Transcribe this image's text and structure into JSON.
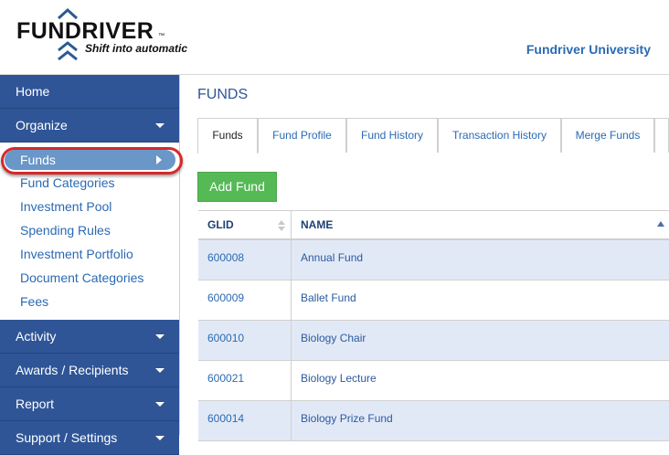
{
  "header": {
    "logo_text": "FUNDRIVER",
    "logo_tm": "™",
    "logo_tagline": "Shift into automatic",
    "org_name": "Fundriver University"
  },
  "sidebar": {
    "top_items": [
      {
        "label": "Home"
      },
      {
        "label": "Organize"
      }
    ],
    "active_item": "Funds",
    "sub_items": [
      {
        "label": "Fund Categories"
      },
      {
        "label": "Investment Pool"
      },
      {
        "label": "Spending Rules"
      },
      {
        "label": "Investment Portfolio"
      },
      {
        "label": "Document Categories"
      },
      {
        "label": "Fees"
      }
    ],
    "bottom_items": [
      {
        "label": "Activity"
      },
      {
        "label": "Awards / Recipients"
      },
      {
        "label": "Report"
      },
      {
        "label": "Support / Settings"
      }
    ]
  },
  "main": {
    "title": "FUNDS",
    "tabs": [
      {
        "label": "Funds"
      },
      {
        "label": "Fund Profile"
      },
      {
        "label": "Fund History"
      },
      {
        "label": "Transaction History"
      },
      {
        "label": "Merge Funds"
      }
    ],
    "add_button": "Add Fund",
    "table": {
      "columns": [
        "GLID",
        "NAME"
      ],
      "rows": [
        {
          "glid": "600008",
          "name": "Annual Fund"
        },
        {
          "glid": "600009",
          "name": "Ballet Fund"
        },
        {
          "glid": "600010",
          "name": "Biology Chair"
        },
        {
          "glid": "600021",
          "name": "Biology Lecture"
        },
        {
          "glid": "600014",
          "name": "Biology Prize Fund"
        }
      ]
    }
  },
  "colors": {
    "nav_bg": "#2f5597",
    "link": "#2a6ab3",
    "add_button": "#55b955",
    "row_stripe": "#e2e9f6",
    "highlight_ring": "#d42a2a"
  }
}
